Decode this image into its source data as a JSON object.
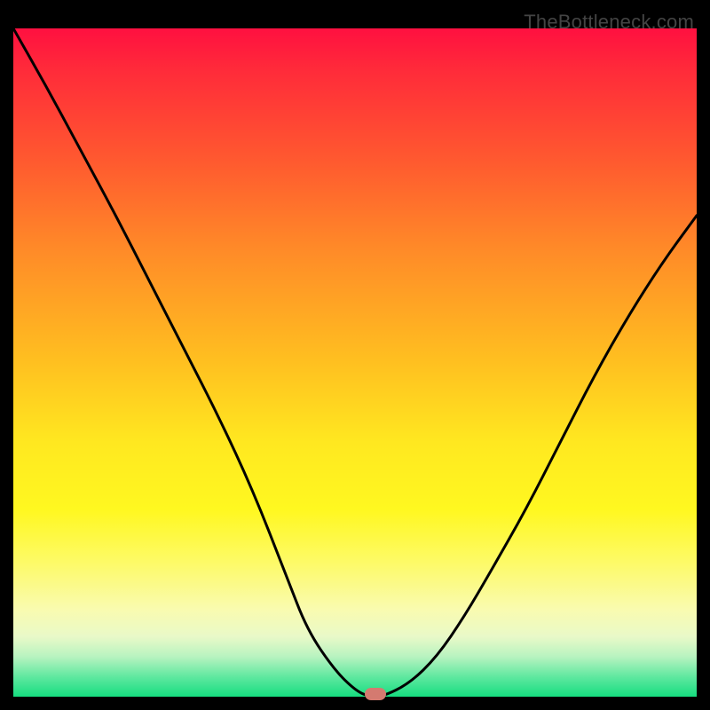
{
  "watermark": "TheBottleneck.com",
  "chart_data": {
    "type": "line",
    "title": "",
    "xlabel": "",
    "ylabel": "",
    "xlim": [
      0,
      100
    ],
    "ylim": [
      0,
      100
    ],
    "grid": false,
    "legend": false,
    "series": [
      {
        "name": "bottleneck-curve",
        "x": [
          0,
          5,
          10,
          15,
          20,
          25,
          30,
          35,
          40,
          43,
          47,
          50,
          52,
          54,
          58,
          62,
          66,
          70,
          75,
          80,
          85,
          90,
          95,
          100
        ],
        "y": [
          100,
          91,
          81.5,
          72,
          62,
          52,
          42,
          31,
          18,
          10,
          4,
          1,
          0,
          0,
          2,
          6,
          12,
          19,
          28,
          38,
          48,
          57,
          65,
          72
        ],
        "note": "y is bottleneck percentage; 0 = ideal (bottom), 100 = worst (top)."
      }
    ],
    "marker": {
      "x": 53,
      "y": 0,
      "label": "optimal-point"
    },
    "colors": {
      "curve": "#000000",
      "marker": "#d47a70",
      "gradient_top": "#ff1040",
      "gradient_mid": "#ffe820",
      "gradient_bottom": "#16dd80",
      "background": "#000000"
    }
  }
}
